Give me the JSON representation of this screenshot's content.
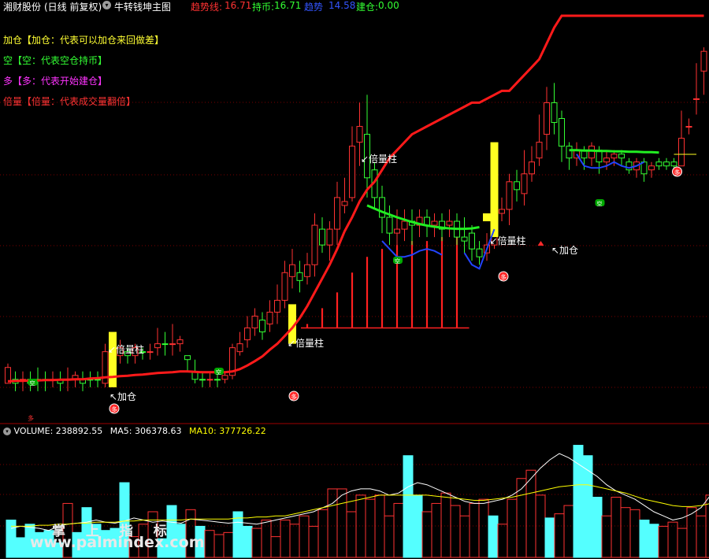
{
  "header": {
    "title": "湘财股份",
    "period": "(日线 前复权)",
    "indicator_name": "牛转钱坤主图",
    "trend_label": "趋势线:",
    "trend_value": "16.71",
    "hold_label": "持币:",
    "hold_value": "16.71",
    "momentum_label": "趋势",
    "momentum_value": "14.58",
    "build_label": "建仓:",
    "build_value": "0.00"
  },
  "legend": [
    {
      "text": "加仓【加仓：代表可以加仓来回做差】",
      "color": "#ffff33"
    },
    {
      "text": "空【空：代表空仓持币】",
      "color": "#33ff33"
    },
    {
      "text": "多【多：代表开始建仓】",
      "color": "#ff33ff"
    },
    {
      "text": "倍量【倍量：代表成交量翻倍】",
      "color": "#ff3333"
    }
  ],
  "annotations": {
    "beiliang": "倍量柱",
    "jiacang": "加仓",
    "duo": "多",
    "kong": "空"
  },
  "volume_header": {
    "volume_label": "VOLUME:",
    "volume_value": "238892.55",
    "ma5_label": "MA5:",
    "ma5_value": "306378.63",
    "ma10_label": "MA10:",
    "ma10_value": "377726.22"
  },
  "watermark": {
    "cn": "掌 上 指 标",
    "url": "www.palmindex.com"
  },
  "colors": {
    "up": "#ff3232",
    "down": "#54ffff",
    "trend": "#ff1a1a",
    "hold": "#22ee22",
    "momentum": "#2244ff",
    "beiliang": "#ffff22",
    "ma5": "#ffffff",
    "ma10": "#ffff00",
    "grid": "#7a0000"
  },
  "chart_data": {
    "type": "candlestick",
    "price_range": [
      9.6,
      19.8
    ],
    "candles": [
      [
        10.9,
        10.5,
        10.6,
        11.0,
        "u"
      ],
      [
        10.6,
        10.5,
        10.3,
        10.8,
        "d"
      ],
      [
        10.6,
        10.6,
        10.3,
        10.8,
        "u"
      ],
      [
        10.6,
        10.5,
        10.3,
        10.8,
        "d"
      ],
      [
        10.6,
        10.6,
        10.3,
        10.9,
        "d"
      ],
      [
        10.6,
        10.6,
        10.3,
        10.8,
        "d"
      ],
      [
        10.6,
        10.6,
        10.4,
        10.8,
        "u"
      ],
      [
        10.6,
        10.5,
        10.3,
        10.8,
        "d"
      ],
      [
        10.6,
        10.6,
        10.3,
        10.9,
        "u"
      ],
      [
        10.7,
        10.6,
        10.4,
        10.8,
        "u"
      ],
      [
        10.6,
        10.5,
        10.3,
        10.8,
        "d"
      ],
      [
        10.6,
        10.6,
        10.4,
        10.8,
        "d"
      ],
      [
        10.6,
        10.6,
        10.4,
        10.8,
        "d"
      ],
      [
        10.5,
        11.3,
        10.4,
        11.5,
        "u"
      ],
      [
        11.3,
        11.2,
        11.0,
        11.4,
        "d"
      ],
      [
        11.2,
        11.4,
        11.0,
        11.6,
        "u"
      ],
      [
        11.3,
        11.2,
        11.0,
        11.4,
        "d"
      ],
      [
        11.2,
        11.4,
        11.0,
        11.5,
        "u"
      ],
      [
        11.3,
        11.3,
        11.1,
        11.4,
        "d"
      ],
      [
        11.3,
        11.3,
        11.1,
        11.5,
        "u"
      ],
      [
        11.4,
        11.5,
        11.2,
        11.9,
        "u"
      ],
      [
        11.5,
        11.5,
        11.2,
        11.8,
        "d"
      ],
      [
        11.5,
        11.5,
        11.2,
        12.0,
        "u"
      ],
      [
        11.5,
        11.6,
        11.3,
        11.7,
        "u"
      ],
      [
        11.2,
        11.1,
        10.8,
        11.2,
        "d"
      ],
      [
        10.8,
        10.6,
        10.5,
        11.1,
        "d"
      ],
      [
        10.6,
        10.6,
        10.4,
        10.8,
        "d"
      ],
      [
        10.6,
        10.6,
        10.4,
        10.8,
        "u"
      ],
      [
        10.6,
        10.6,
        10.4,
        10.8,
        "d"
      ],
      [
        10.6,
        10.7,
        10.5,
        10.8,
        "u"
      ],
      [
        10.7,
        11.4,
        10.6,
        11.5,
        "u"
      ],
      [
        11.3,
        11.5,
        11.2,
        11.8,
        "u"
      ],
      [
        11.6,
        11.9,
        11.4,
        12.2,
        "u"
      ],
      [
        11.9,
        12.2,
        11.7,
        12.4,
        "u"
      ],
      [
        12.1,
        11.8,
        11.6,
        12.3,
        "d"
      ],
      [
        12.0,
        12.3,
        11.8,
        12.6,
        "u"
      ],
      [
        12.3,
        12.6,
        12.0,
        13.0,
        "u"
      ],
      [
        12.6,
        13.3,
        12.4,
        13.6,
        "u"
      ],
      [
        13.2,
        13.5,
        12.9,
        13.9,
        "u"
      ],
      [
        13.3,
        13.1,
        12.8,
        13.6,
        "d"
      ],
      [
        13.2,
        13.5,
        13.0,
        13.8,
        "u"
      ],
      [
        13.5,
        14.5,
        13.2,
        14.8,
        "u"
      ],
      [
        14.4,
        14.0,
        13.8,
        14.7,
        "d"
      ],
      [
        14.0,
        14.4,
        13.6,
        14.6,
        "u"
      ],
      [
        14.4,
        15.2,
        14.0,
        15.6,
        "u"
      ],
      [
        15.0,
        15.1,
        14.8,
        15.7,
        "u"
      ],
      [
        15.2,
        16.5,
        15.1,
        17.0,
        "u"
      ],
      [
        16.6,
        17.0,
        16.0,
        17.6,
        "u"
      ],
      [
        16.8,
        15.7,
        15.2,
        17.8,
        "d"
      ],
      [
        15.9,
        15.2,
        14.9,
        16.1,
        "d"
      ],
      [
        15.2,
        14.7,
        14.3,
        15.5,
        "d"
      ],
      [
        14.7,
        14.3,
        14.0,
        15.0,
        "d"
      ],
      [
        14.3,
        14.4,
        14.0,
        14.9,
        "u"
      ],
      [
        14.4,
        14.6,
        14.1,
        14.9,
        "u"
      ],
      [
        14.6,
        14.5,
        14.0,
        14.9,
        "d"
      ],
      [
        14.5,
        14.7,
        14.2,
        14.9,
        "u"
      ],
      [
        14.7,
        14.5,
        14.2,
        14.9,
        "d"
      ],
      [
        14.5,
        14.6,
        14.2,
        14.8,
        "u"
      ],
      [
        14.6,
        14.4,
        14.1,
        14.8,
        "d"
      ],
      [
        14.5,
        14.6,
        14.2,
        14.9,
        "u"
      ],
      [
        14.6,
        14.2,
        14.0,
        14.8,
        "d"
      ],
      [
        14.2,
        14.1,
        13.8,
        14.7,
        "d"
      ],
      [
        14.3,
        13.9,
        13.6,
        14.5,
        "d"
      ],
      [
        13.9,
        13.7,
        13.5,
        14.1,
        "d"
      ],
      [
        13.8,
        14.0,
        13.6,
        14.3,
        "u"
      ],
      [
        14.0,
        14.8,
        13.9,
        15.0,
        "u"
      ],
      [
        14.8,
        14.9,
        14.6,
        15.2,
        "u"
      ],
      [
        14.9,
        15.6,
        14.5,
        15.8,
        "u"
      ],
      [
        15.6,
        15.4,
        15.1,
        15.9,
        "d"
      ],
      [
        15.3,
        15.8,
        15.0,
        16.4,
        "u"
      ],
      [
        15.8,
        16.1,
        15.6,
        16.5,
        "u"
      ],
      [
        16.2,
        16.6,
        16.0,
        17.3,
        "u"
      ],
      [
        16.8,
        17.6,
        16.4,
        18.0,
        "u"
      ],
      [
        17.6,
        17.1,
        16.8,
        18.1,
        "d"
      ],
      [
        17.2,
        16.5,
        16.1,
        17.4,
        "d"
      ],
      [
        16.5,
        16.2,
        15.9,
        16.6,
        "d"
      ],
      [
        16.2,
        16.4,
        16.0,
        16.6,
        "u"
      ],
      [
        16.4,
        16.2,
        15.9,
        16.5,
        "d"
      ],
      [
        16.2,
        16.5,
        16.0,
        16.6,
        "u"
      ],
      [
        16.4,
        16.1,
        15.8,
        16.5,
        "d"
      ],
      [
        16.1,
        16.2,
        15.9,
        16.4,
        "u"
      ],
      [
        16.2,
        16.3,
        16.0,
        16.4,
        "u"
      ],
      [
        16.3,
        16.2,
        16.0,
        16.4,
        "d"
      ],
      [
        16.1,
        15.9,
        15.8,
        16.2,
        "d"
      ],
      [
        15.9,
        16.1,
        15.7,
        16.2,
        "u"
      ],
      [
        16.1,
        15.8,
        15.6,
        16.2,
        "d"
      ],
      [
        15.9,
        16.0,
        15.7,
        16.1,
        "u"
      ],
      [
        16.0,
        16.1,
        15.9,
        16.2,
        "d"
      ],
      [
        16.0,
        16.1,
        15.9,
        16.2,
        "d"
      ],
      [
        16.1,
        16.0,
        15.9,
        16.2,
        "d"
      ],
      [
        16.0,
        16.7,
        16.0,
        17.4,
        "u"
      ],
      [
        17.0,
        17.0,
        16.8,
        17.2,
        "u"
      ],
      [
        17.7,
        17.7,
        17.3,
        18.6,
        "u"
      ],
      [
        18.4,
        18.9,
        17.8,
        19.0,
        "u"
      ]
    ],
    "trend_line": [
      10.55,
      10.56,
      10.56,
      10.57,
      10.57,
      10.58,
      10.58,
      10.59,
      10.59,
      10.6,
      10.6,
      10.62,
      10.63,
      10.65,
      10.66,
      10.68,
      10.69,
      10.71,
      10.72,
      10.74,
      10.76,
      10.77,
      10.78,
      10.8,
      10.8,
      10.79,
      10.78,
      10.78,
      10.78,
      10.78,
      10.8,
      10.86,
      10.95,
      11.06,
      11.18,
      11.35,
      11.5,
      11.7,
      11.9,
      12.15,
      12.45,
      12.8,
      13.15,
      13.5,
      13.9,
      14.35,
      14.7,
      15.1,
      15.4,
      15.6,
      15.9,
      16.2,
      16.4,
      16.6,
      16.8,
      16.9,
      17.0,
      17.1,
      17.2,
      17.3,
      17.4,
      17.5,
      17.6,
      17.6,
      17.7,
      17.8,
      17.9,
      17.9,
      18.1,
      18.3,
      18.5,
      18.7,
      19.1,
      19.5,
      19.9,
      20.3,
      20.5,
      20.8,
      21.0,
      21.1,
      21.2,
      21.3,
      21.4,
      21.5,
      21.6,
      21.6,
      21.7,
      21.8,
      21.8,
      21.9,
      22.0,
      22.3,
      22.6,
      22.9
    ],
    "hold_line": {
      "start_index": 48,
      "values": [
        15.0,
        14.92,
        14.84,
        14.77,
        14.7,
        14.64,
        14.58,
        14.53,
        14.49,
        14.46,
        14.44,
        14.42,
        14.41,
        14.41,
        14.42,
        14.45
      ]
    },
    "hold_line_2": {
      "start_index": 75,
      "values": [
        16.4,
        16.4,
        16.39,
        16.39,
        16.38,
        16.38,
        16.37,
        16.37,
        16.36,
        16.36,
        16.35,
        16.35,
        16.34
      ]
    },
    "momentum_line": [
      {
        "start_index": 50,
        "values": [
          14.1,
          13.9,
          13.7,
          13.7,
          13.75,
          13.85,
          13.9,
          13.85,
          13.75
        ]
      },
      {
        "start_index": 61,
        "values": [
          13.8,
          13.5,
          13.4,
          13.9,
          14.4
        ]
      },
      {
        "start_index": 76,
        "values": [
          16.3,
          16.0,
          15.95,
          15.95,
          16.0,
          16.1,
          16.0,
          15.95,
          16.0,
          16.1
        ]
      }
    ],
    "bei_liang_bars": [
      {
        "index": 14,
        "low": 10.4,
        "high": 11.8
      },
      {
        "index": 38,
        "low": 11.5,
        "high": 12.5
      },
      {
        "index": 65,
        "low": 14.2,
        "high": 16.6
      },
      {
        "index": 64,
        "low": 14.6,
        "high": 14.8
      }
    ],
    "red_spikes": [
      {
        "index": 40,
        "top": 12.0
      },
      {
        "index": 42,
        "top": 12.4
      },
      {
        "index": 44,
        "top": 12.8
      },
      {
        "index": 46,
        "top": 13.3
      },
      {
        "index": 48,
        "top": 13.7
      },
      {
        "index": 50,
        "top": 13.9
      },
      {
        "index": 52,
        "top": 14.0
      },
      {
        "index": 54,
        "top": 14.1
      },
      {
        "index": 56,
        "top": 14.1
      },
      {
        "index": 58,
        "top": 14.2
      },
      {
        "index": 60,
        "top": 14.4
      }
    ],
    "volume": {
      "range": [
        0,
        580000
      ],
      "bars": [
        [
          180000,
          "d"
        ],
        [
          95000,
          "d"
        ],
        [
          160000,
          "d"
        ],
        [
          120000,
          "d"
        ],
        [
          130000,
          "d"
        ],
        [
          70000,
          "d"
        ],
        [
          260000,
          "u"
        ],
        [
          120000,
          "d"
        ],
        [
          240000,
          "d"
        ],
        [
          160000,
          "d"
        ],
        [
          130000,
          "d"
        ],
        [
          140000,
          "d"
        ],
        [
          360000,
          "d"
        ],
        [
          100000,
          "u"
        ],
        [
          160000,
          "u"
        ],
        [
          220000,
          "u"
        ],
        [
          90000,
          "d"
        ],
        [
          250000,
          "d"
        ],
        [
          160000,
          "d"
        ],
        [
          230000,
          "u"
        ],
        [
          150000,
          "d"
        ],
        [
          130000,
          "u"
        ],
        [
          110000,
          "u"
        ],
        [
          120000,
          "u"
        ],
        [
          220000,
          "d"
        ],
        [
          150000,
          "d"
        ],
        [
          140000,
          "u"
        ],
        [
          180000,
          "u"
        ],
        [
          100000,
          "u"
        ],
        [
          180000,
          "u"
        ],
        [
          160000,
          "u"
        ],
        [
          200000,
          "u"
        ],
        [
          150000,
          "u"
        ],
        [
          230000,
          "u"
        ],
        [
          330000,
          "u"
        ],
        [
          330000,
          "u"
        ],
        [
          220000,
          "u"
        ],
        [
          300000,
          "u"
        ],
        [
          280000,
          "u"
        ],
        [
          300000,
          "u"
        ],
        [
          200000,
          "u"
        ],
        [
          260000,
          "u"
        ],
        [
          490000,
          "d"
        ],
        [
          300000,
          "d"
        ],
        [
          220000,
          "u"
        ],
        [
          260000,
          "u"
        ],
        [
          310000,
          "u"
        ],
        [
          250000,
          "u"
        ],
        [
          200000,
          "u"
        ],
        [
          260000,
          "u"
        ],
        [
          280000,
          "u"
        ],
        [
          200000,
          "d"
        ],
        [
          160000,
          "u"
        ],
        [
          280000,
          "u"
        ],
        [
          380000,
          "u"
        ],
        [
          420000,
          "u"
        ],
        [
          300000,
          "u"
        ],
        [
          190000,
          "d"
        ],
        [
          210000,
          "u"
        ],
        [
          250000,
          "u"
        ],
        [
          540000,
          "d"
        ],
        [
          490000,
          "d"
        ],
        [
          290000,
          "d"
        ],
        [
          200000,
          "u"
        ],
        [
          290000,
          "u"
        ],
        [
          240000,
          "u"
        ],
        [
          230000,
          "u"
        ],
        [
          180000,
          "d"
        ],
        [
          160000,
          "d"
        ],
        [
          150000,
          "u"
        ],
        [
          170000,
          "u"
        ],
        [
          140000,
          "u"
        ],
        [
          240000,
          "u"
        ],
        [
          200000,
          "u"
        ],
        [
          300000,
          "u"
        ]
      ],
      "ma5": [
        140000,
        150000,
        145000,
        140000,
        130000,
        150000,
        160000,
        165000,
        170000,
        180000,
        170000,
        165000,
        175000,
        190000,
        180000,
        170000,
        175000,
        170000,
        165000,
        185000,
        180000,
        175000,
        170000,
        165000,
        170000,
        165000,
        160000,
        170000,
        180000,
        190000,
        200000,
        210000,
        220000,
        240000,
        260000,
        300000,
        320000,
        330000,
        330000,
        320000,
        300000,
        310000,
        340000,
        360000,
        350000,
        330000,
        310000,
        290000,
        270000,
        260000,
        260000,
        270000,
        280000,
        300000,
        330000,
        380000,
        430000,
        470000,
        500000,
        480000,
        450000,
        420000,
        390000,
        350000,
        320000,
        300000,
        280000,
        250000,
        220000,
        200000,
        180000,
        190000,
        210000,
        240000,
        300000
      ],
      "ma10": [
        150000,
        150000,
        150000,
        155000,
        155000,
        160000,
        160000,
        165000,
        165000,
        170000,
        170000,
        170000,
        175000,
        175000,
        180000,
        180000,
        180000,
        180000,
        180000,
        185000,
        185000,
        185000,
        185000,
        185000,
        190000,
        190000,
        195000,
        195000,
        200000,
        200000,
        210000,
        220000,
        230000,
        240000,
        250000,
        260000,
        270000,
        280000,
        290000,
        300000,
        300000,
        300000,
        300000,
        300000,
        300000,
        295000,
        290000,
        285000,
        280000,
        275000,
        275000,
        280000,
        285000,
        290000,
        300000,
        310000,
        320000,
        330000,
        340000,
        345000,
        350000,
        350000,
        340000,
        330000,
        320000,
        310000,
        295000,
        280000,
        270000,
        260000,
        250000,
        245000,
        245000,
        250000,
        260000
      ]
    }
  }
}
